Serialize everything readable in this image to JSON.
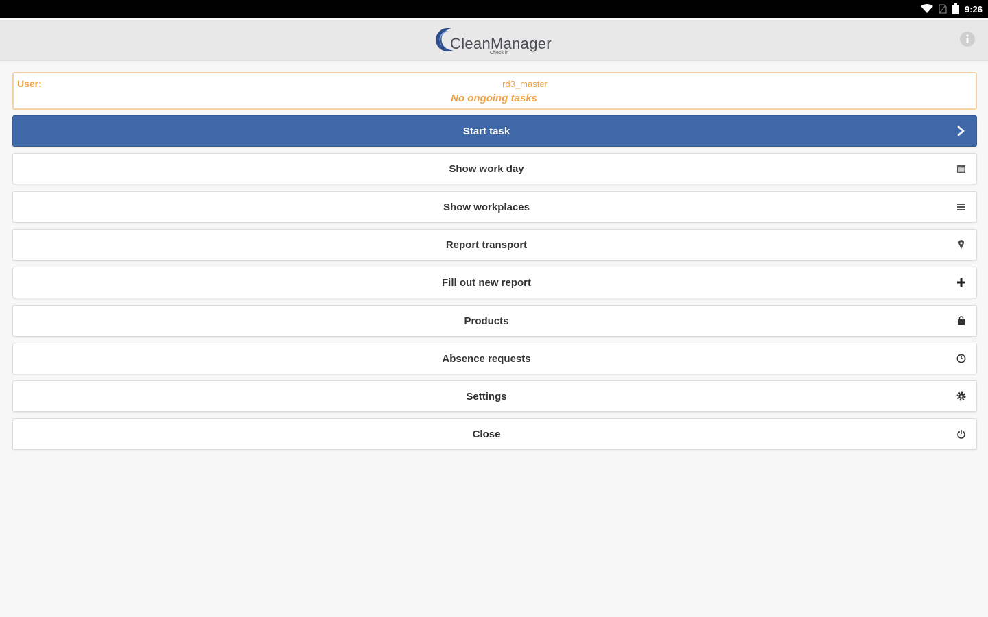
{
  "status_bar": {
    "time": "9:26",
    "icons": [
      "wifi-icon",
      "sim-icon",
      "battery-icon"
    ]
  },
  "header": {
    "logo_text": "CleanManager",
    "logo_subtitle": "Check in",
    "info_icon": "info-icon"
  },
  "user_card": {
    "label": "User:",
    "username": "rd3_master",
    "status": "No ongoing tasks"
  },
  "menu": {
    "items": [
      {
        "label": "Start task",
        "icon": "chevron-right-icon",
        "primary": true
      },
      {
        "label": "Show work day",
        "icon": "calendar-icon"
      },
      {
        "label": "Show workplaces",
        "icon": "list-icon"
      },
      {
        "label": "Report transport",
        "icon": "map-pin-icon"
      },
      {
        "label": "Fill out new report",
        "icon": "plus-icon"
      },
      {
        "label": "Products",
        "icon": "shopping-bag-icon"
      },
      {
        "label": "Absence requests",
        "icon": "clock-icon"
      },
      {
        "label": "Settings",
        "icon": "gear-icon"
      },
      {
        "label": "Close",
        "icon": "power-icon"
      }
    ]
  },
  "colors": {
    "primary": "#3f68a8",
    "accent_orange": "#f0a345",
    "status_bar": "#000000",
    "header_bg": "#e8e8e9"
  }
}
